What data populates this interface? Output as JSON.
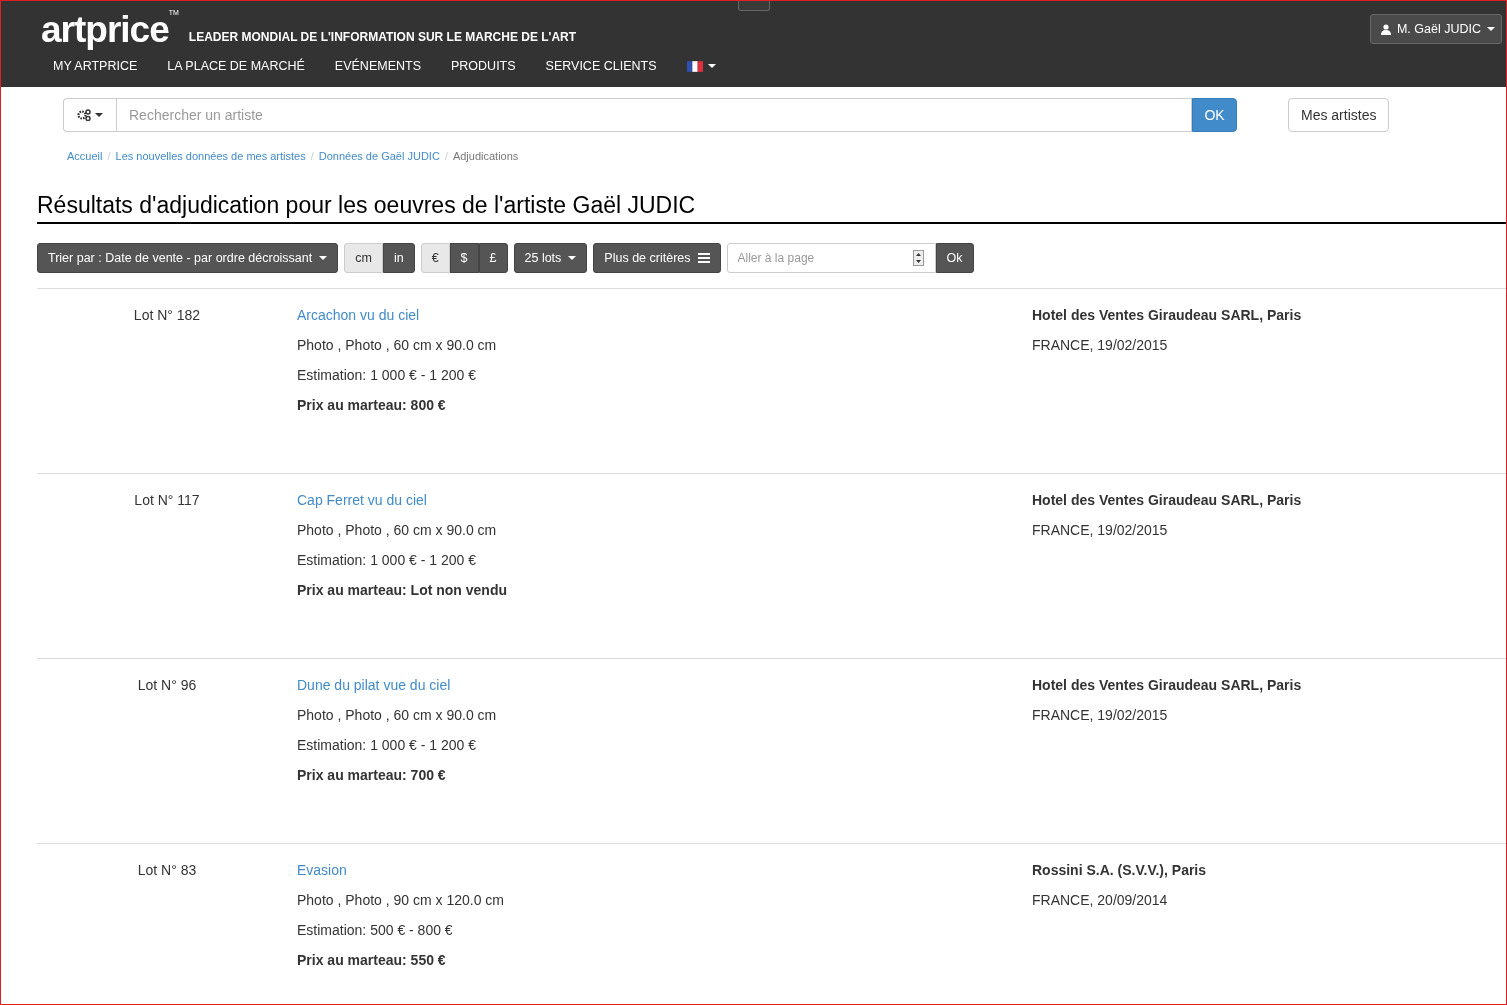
{
  "header": {
    "logo": "artprice",
    "trademark": "TM",
    "tagline": "LEADER MONDIAL DE L'INFORMATION SUR LE MARCHE DE L'ART",
    "user": "M. Gaël JUDIC",
    "nav": [
      {
        "label": "MY ARTPRICE"
      },
      {
        "label": "LA PLACE DE MARCHÉ"
      },
      {
        "label": "EVÉNEMENTS"
      },
      {
        "label": "PRODUITS"
      },
      {
        "label": "SERVICE CLIENTS"
      }
    ]
  },
  "search": {
    "placeholder": "Rechercher un artiste",
    "submit": "OK",
    "my_artists": "Mes artistes"
  },
  "breadcrumb_separator": "/",
  "breadcrumb": [
    {
      "label": "Accueil",
      "link": true
    },
    {
      "label": "Les nouvelles données de mes artistes",
      "link": true
    },
    {
      "label": "Données de Gaël JUDIC",
      "link": true
    },
    {
      "label": "Adjudications",
      "link": false
    }
  ],
  "title": "Résultats d'adjudication pour les oeuvres de l'artiste Gaël JUDIC",
  "toolbar": {
    "sort": "Trier par : Date de vente - par ordre décroissant",
    "units": [
      {
        "label": "cm",
        "selected": true
      },
      {
        "label": "in",
        "selected": false
      }
    ],
    "currencies": [
      {
        "label": "€",
        "selected": true
      },
      {
        "label": "$",
        "selected": false
      },
      {
        "label": "£",
        "selected": false
      }
    ],
    "per_page": "25 lots",
    "more": "Plus de critères",
    "page_placeholder": "Aller à la page",
    "go": "Ok"
  },
  "lots": [
    {
      "lot": "Lot N° 182",
      "title": "Arcachon vu du ciel",
      "medium": "Photo , Photo , 60 cm x 90.0 cm",
      "estimate": "Estimation: 1 000 € - 1 200 €",
      "price": "Prix au marteau: 800 €",
      "house": "Hotel des Ventes Giraudeau SARL, Paris",
      "place_date": "FRANCE, 19/02/2015"
    },
    {
      "lot": "Lot N° 117",
      "title": "Cap Ferret vu du ciel",
      "medium": "Photo , Photo , 60 cm x 90.0 cm",
      "estimate": "Estimation: 1 000 € - 1 200 €",
      "price": "Prix au marteau: Lot non vendu",
      "house": "Hotel des Ventes Giraudeau SARL, Paris",
      "place_date": "FRANCE, 19/02/2015"
    },
    {
      "lot": "Lot N° 96",
      "title": "Dune du pilat vue du ciel",
      "medium": "Photo , Photo , 60 cm x 90.0 cm",
      "estimate": "Estimation: 1 000 € - 1 200 €",
      "price": "Prix au marteau: 700 €",
      "house": "Hotel des Ventes Giraudeau SARL, Paris",
      "place_date": "FRANCE, 19/02/2015"
    },
    {
      "lot": "Lot N° 83",
      "title": "Evasion",
      "medium": "Photo , Photo , 90 cm x 120.0 cm",
      "estimate": "Estimation: 500 € - 800 €",
      "price": "Prix au marteau: 550 €",
      "house": "Rossini S.A. (S.V.V.), Paris",
      "place_date": "FRANCE, 20/09/2014"
    }
  ]
}
